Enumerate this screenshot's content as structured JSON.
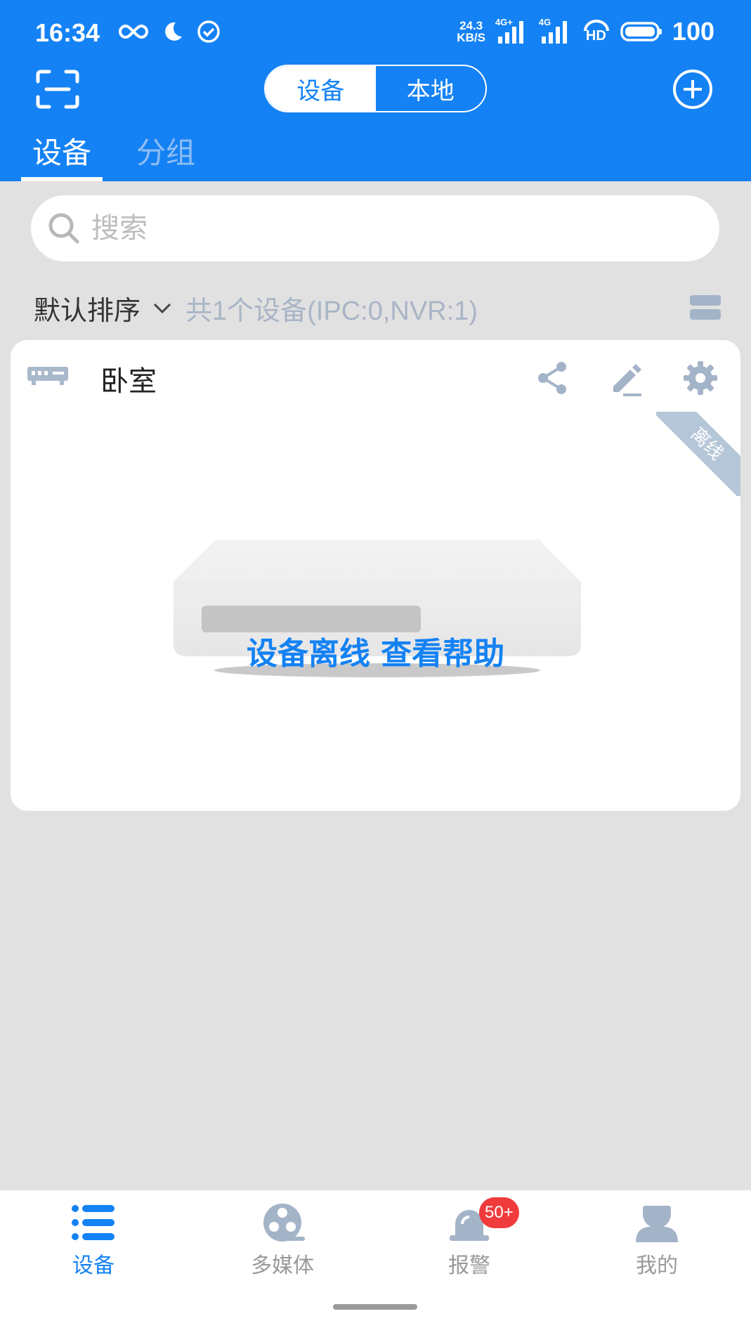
{
  "status_bar": {
    "time": "16:34",
    "net_speed_value": "24.3",
    "net_speed_unit": "KB/S",
    "signal1_label": "4G+",
    "signal2_label": "4G",
    "hd_label": "HD",
    "battery": "100"
  },
  "header": {
    "segment": {
      "active": "设备",
      "inactive": "本地"
    },
    "tabs": [
      {
        "label": "设备",
        "active": true
      },
      {
        "label": "分组",
        "active": false
      }
    ]
  },
  "search": {
    "placeholder": "搜索",
    "value": ""
  },
  "sort": {
    "label": "默认排序",
    "count_text": "共1个设备(IPC:0,NVR:1)"
  },
  "device_card": {
    "name": "卧室",
    "status_ribbon": "离线",
    "offline_link": "设备离线 查看帮助"
  },
  "bottom_nav": [
    {
      "label": "设备",
      "icon": "list-icon",
      "active": true
    },
    {
      "label": "多媒体",
      "icon": "film-reel-icon",
      "active": false
    },
    {
      "label": "报警",
      "icon": "alarm-siren-icon",
      "active": false,
      "badge": "50+"
    },
    {
      "label": "我的",
      "icon": "user-icon",
      "active": false
    }
  ],
  "colors": {
    "primary": "#1482f4",
    "background": "#e1e1e1",
    "icon_gray": "#a4b4c8",
    "badge_red": "#ef3b3b"
  }
}
